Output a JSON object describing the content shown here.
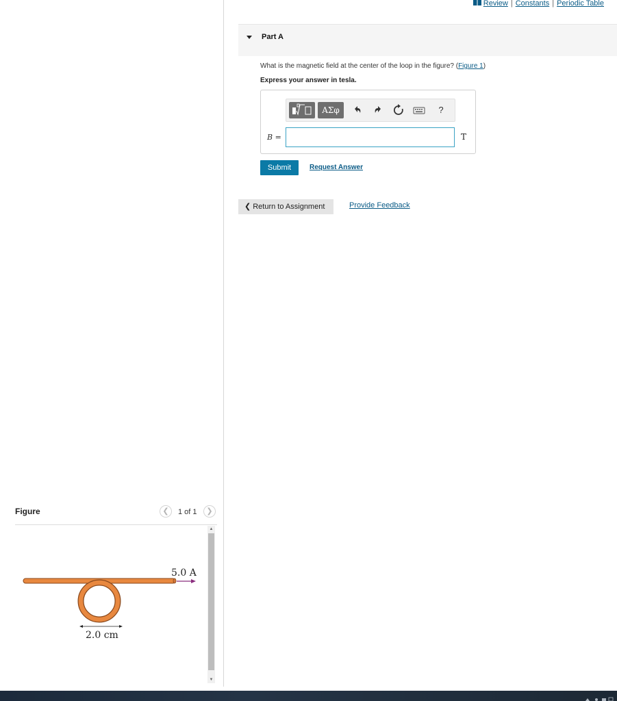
{
  "top_links": {
    "review": "Review",
    "constants": "Constants",
    "periodic_table": "Periodic Table",
    "separator": "|",
    "review_icon": "book-icon"
  },
  "part": {
    "title": "Part A",
    "caret_icon": "caret-down-icon"
  },
  "question": {
    "text": "What is the magnetic field at the center of the loop in the figure? (",
    "figure_link": "Figure 1",
    "close_paren": ")",
    "instruction": "Express your answer in tesla."
  },
  "answer": {
    "variable": "B",
    "equals": " =",
    "value": "",
    "unit": "T",
    "toolbar": {
      "math_templates_icon": "fraction-radical-icon",
      "greek_label": "ΑΣφ",
      "undo_icon": "undo-icon",
      "redo_icon": "redo-icon",
      "reset_icon": "reset-icon",
      "keyboard_icon": "keyboard-icon",
      "help_label": "?"
    }
  },
  "actions": {
    "submit": "Submit",
    "request_answer": "Request Answer",
    "return": "Return to Assignment",
    "feedback": "Provide Feedback"
  },
  "figure": {
    "title": "Figure",
    "pager_text": "1 of 1",
    "prev_icon": "chevron-left-icon",
    "next_icon": "chevron-right-icon",
    "current_label": "5.0 A",
    "diameter_label": "2.0 cm",
    "colors": {
      "wire": "#e8883f",
      "wire_edge": "#8a4a1e",
      "current_arrow": "#8b2d7e"
    }
  },
  "colors": {
    "link": "#0a5b86",
    "submit": "#0b7aa6",
    "input_border": "#39a2c4"
  }
}
